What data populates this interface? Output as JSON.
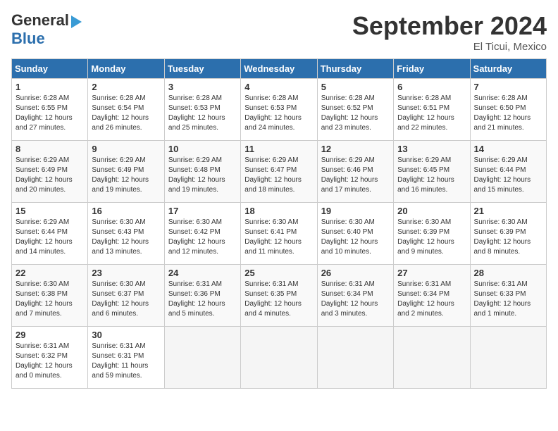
{
  "logo": {
    "line1": "General",
    "line2": "Blue",
    "arrow": "▶"
  },
  "title": "September 2024",
  "location": "El Ticui, Mexico",
  "days_header": [
    "Sunday",
    "Monday",
    "Tuesday",
    "Wednesday",
    "Thursday",
    "Friday",
    "Saturday"
  ],
  "weeks": [
    [
      {
        "num": "1",
        "info": "Sunrise: 6:28 AM\nSunset: 6:55 PM\nDaylight: 12 hours\nand 27 minutes."
      },
      {
        "num": "2",
        "info": "Sunrise: 6:28 AM\nSunset: 6:54 PM\nDaylight: 12 hours\nand 26 minutes."
      },
      {
        "num": "3",
        "info": "Sunrise: 6:28 AM\nSunset: 6:53 PM\nDaylight: 12 hours\nand 25 minutes."
      },
      {
        "num": "4",
        "info": "Sunrise: 6:28 AM\nSunset: 6:53 PM\nDaylight: 12 hours\nand 24 minutes."
      },
      {
        "num": "5",
        "info": "Sunrise: 6:28 AM\nSunset: 6:52 PM\nDaylight: 12 hours\nand 23 minutes."
      },
      {
        "num": "6",
        "info": "Sunrise: 6:28 AM\nSunset: 6:51 PM\nDaylight: 12 hours\nand 22 minutes."
      },
      {
        "num": "7",
        "info": "Sunrise: 6:28 AM\nSunset: 6:50 PM\nDaylight: 12 hours\nand 21 minutes."
      }
    ],
    [
      {
        "num": "8",
        "info": "Sunrise: 6:29 AM\nSunset: 6:49 PM\nDaylight: 12 hours\nand 20 minutes."
      },
      {
        "num": "9",
        "info": "Sunrise: 6:29 AM\nSunset: 6:49 PM\nDaylight: 12 hours\nand 19 minutes."
      },
      {
        "num": "10",
        "info": "Sunrise: 6:29 AM\nSunset: 6:48 PM\nDaylight: 12 hours\nand 19 minutes."
      },
      {
        "num": "11",
        "info": "Sunrise: 6:29 AM\nSunset: 6:47 PM\nDaylight: 12 hours\nand 18 minutes."
      },
      {
        "num": "12",
        "info": "Sunrise: 6:29 AM\nSunset: 6:46 PM\nDaylight: 12 hours\nand 17 minutes."
      },
      {
        "num": "13",
        "info": "Sunrise: 6:29 AM\nSunset: 6:45 PM\nDaylight: 12 hours\nand 16 minutes."
      },
      {
        "num": "14",
        "info": "Sunrise: 6:29 AM\nSunset: 6:44 PM\nDaylight: 12 hours\nand 15 minutes."
      }
    ],
    [
      {
        "num": "15",
        "info": "Sunrise: 6:29 AM\nSunset: 6:44 PM\nDaylight: 12 hours\nand 14 minutes."
      },
      {
        "num": "16",
        "info": "Sunrise: 6:30 AM\nSunset: 6:43 PM\nDaylight: 12 hours\nand 13 minutes."
      },
      {
        "num": "17",
        "info": "Sunrise: 6:30 AM\nSunset: 6:42 PM\nDaylight: 12 hours\nand 12 minutes."
      },
      {
        "num": "18",
        "info": "Sunrise: 6:30 AM\nSunset: 6:41 PM\nDaylight: 12 hours\nand 11 minutes."
      },
      {
        "num": "19",
        "info": "Sunrise: 6:30 AM\nSunset: 6:40 PM\nDaylight: 12 hours\nand 10 minutes."
      },
      {
        "num": "20",
        "info": "Sunrise: 6:30 AM\nSunset: 6:39 PM\nDaylight: 12 hours\nand 9 minutes."
      },
      {
        "num": "21",
        "info": "Sunrise: 6:30 AM\nSunset: 6:39 PM\nDaylight: 12 hours\nand 8 minutes."
      }
    ],
    [
      {
        "num": "22",
        "info": "Sunrise: 6:30 AM\nSunset: 6:38 PM\nDaylight: 12 hours\nand 7 minutes."
      },
      {
        "num": "23",
        "info": "Sunrise: 6:30 AM\nSunset: 6:37 PM\nDaylight: 12 hours\nand 6 minutes."
      },
      {
        "num": "24",
        "info": "Sunrise: 6:31 AM\nSunset: 6:36 PM\nDaylight: 12 hours\nand 5 minutes."
      },
      {
        "num": "25",
        "info": "Sunrise: 6:31 AM\nSunset: 6:35 PM\nDaylight: 12 hours\nand 4 minutes."
      },
      {
        "num": "26",
        "info": "Sunrise: 6:31 AM\nSunset: 6:34 PM\nDaylight: 12 hours\nand 3 minutes."
      },
      {
        "num": "27",
        "info": "Sunrise: 6:31 AM\nSunset: 6:34 PM\nDaylight: 12 hours\nand 2 minutes."
      },
      {
        "num": "28",
        "info": "Sunrise: 6:31 AM\nSunset: 6:33 PM\nDaylight: 12 hours\nand 1 minute."
      }
    ],
    [
      {
        "num": "29",
        "info": "Sunrise: 6:31 AM\nSunset: 6:32 PM\nDaylight: 12 hours\nand 0 minutes."
      },
      {
        "num": "30",
        "info": "Sunrise: 6:31 AM\nSunset: 6:31 PM\nDaylight: 11 hours\nand 59 minutes."
      },
      {
        "num": "",
        "info": ""
      },
      {
        "num": "",
        "info": ""
      },
      {
        "num": "",
        "info": ""
      },
      {
        "num": "",
        "info": ""
      },
      {
        "num": "",
        "info": ""
      }
    ]
  ]
}
